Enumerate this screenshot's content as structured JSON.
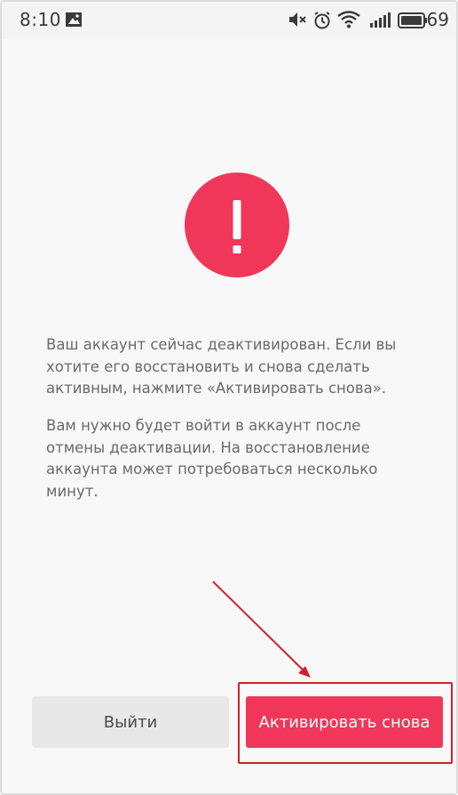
{
  "status_bar": {
    "time": "8:10",
    "battery_level": "69",
    "icons": [
      "image-notification-icon",
      "mute-icon",
      "alarm-icon",
      "wifi-icon",
      "signal-icon",
      "battery-icon"
    ]
  },
  "dialog": {
    "icon": "exclamation-icon",
    "paragraph_1": "Ваш аккаунт сейчас деактивирован. Если вы хотите его восстановить и снова сделать активным, нажмите «Активировать снова».",
    "paragraph_2": "Вам нужно будет войти в аккаунт после отмены деактивации. На восстановление аккаунта может потребоваться несколько минут."
  },
  "buttons": {
    "exit_label": "Выйти",
    "activate_label": "Активировать снова"
  },
  "colors": {
    "accent": "#f0375a",
    "annotation_red": "#d2202f",
    "secondary_button": "#e8e8e8"
  }
}
